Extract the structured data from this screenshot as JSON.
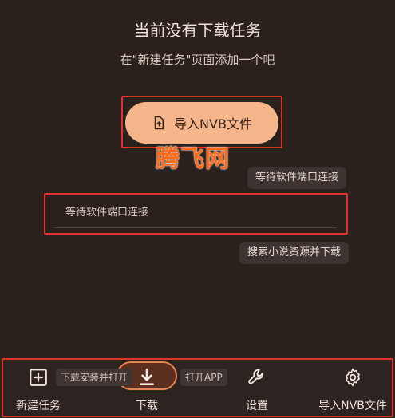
{
  "empty_state": {
    "title": "当前没有下载任务",
    "subtitle": "在\"新建任务\"页面添加一个吧"
  },
  "import_button": {
    "label": "导入NVB文件",
    "icon": "file-upload-icon"
  },
  "watermark": "腾飞网",
  "tooltips": {
    "connection_wait": "等待软件端口连接",
    "search_sources": "搜索小说资源并下载"
  },
  "status_field": {
    "value": "等待软件端口连接"
  },
  "bottom_nav": {
    "new_task": {
      "label": "新建任务",
      "icon": "plus-square-icon",
      "tooltip": "下载安装并打开"
    },
    "download": {
      "label": "下载",
      "icon": "download-icon",
      "tooltip": "打开APP",
      "active": true
    },
    "settings": {
      "label": "设置",
      "icon": "wrench-icon"
    },
    "import_nvb": {
      "label": "导入NVB文件",
      "icon": "gear-icon"
    }
  },
  "colors": {
    "background": "#2a201c",
    "accent": "#f5b58a",
    "highlight_box": "#e0332d",
    "watermark": "#ff6a1a"
  }
}
